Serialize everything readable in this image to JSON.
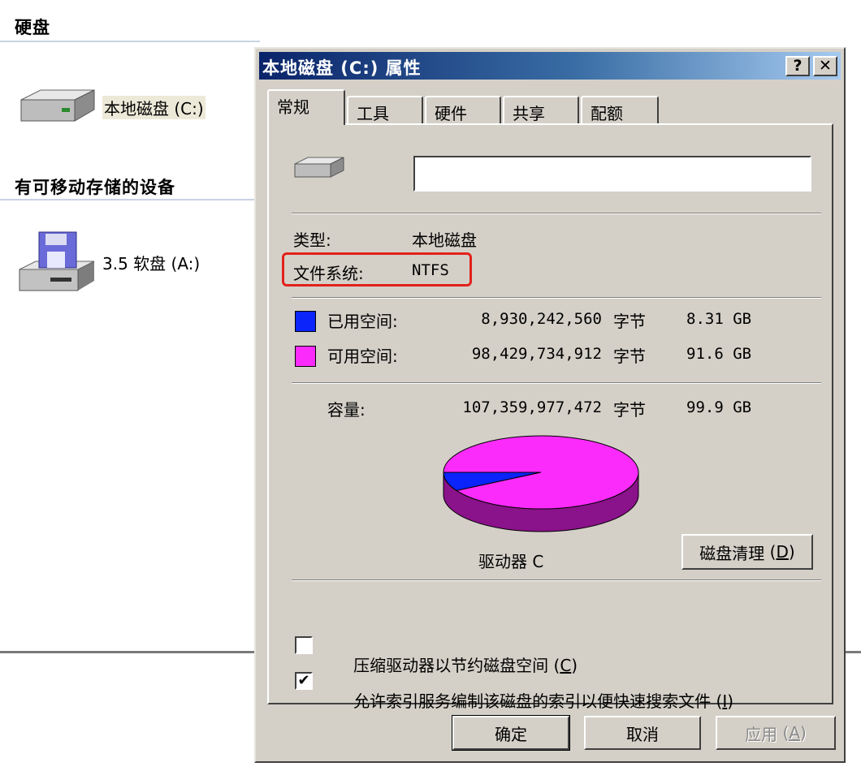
{
  "explorer": {
    "hard_disk_header": "硬盘",
    "local_disk_label": "本地磁盘 (C:)",
    "removable_header": "有可移动存储的设备",
    "floppy_label": "3.5 软盘 (A:)"
  },
  "dialog": {
    "title": "本地磁盘 (C:) 属性",
    "help_button": "?",
    "close_button": "✕",
    "tabs": [
      {
        "label": "常规",
        "active": true
      },
      {
        "label": "工具"
      },
      {
        "label": "硬件"
      },
      {
        "label": "共享"
      },
      {
        "label": "配额"
      }
    ],
    "volume_name_value": "",
    "type_label": "类型:",
    "type_value": "本地磁盘",
    "fs_label": "文件系统:",
    "fs_value": "NTFS",
    "used": {
      "label": "已用空间:",
      "bytes": "8,930,242,560",
      "unit": "字节",
      "size": "8.31 GB",
      "color": "#0b24fb"
    },
    "free": {
      "label": "可用空间:",
      "bytes": "98,429,734,912",
      "unit": "字节",
      "size": "91.6 GB",
      "color": "#fb2bfb"
    },
    "capacity": {
      "label": "容量:",
      "bytes": "107,359,977,472",
      "unit": "字节",
      "size": "99.9 GB"
    },
    "drive_label": "驱动器 C",
    "cleanup_button": "磁盘清理",
    "cleanup_key": "D",
    "compress_label": "压缩驱动器以节约磁盘空间",
    "compress_key": "C",
    "compress_checked": false,
    "index_label": "允许索引服务编制该磁盘的索引以便快速搜索文件",
    "index_key": "I",
    "index_checked": true,
    "ok_button": "确定",
    "cancel_button": "取消",
    "apply_button": "应用",
    "apply_key": "A"
  },
  "chart_data": {
    "type": "pie",
    "title": "",
    "categories": [
      "已用空间",
      "可用空间"
    ],
    "values": [
      8930242560,
      98429734912
    ],
    "colors": [
      "#0b24fb",
      "#fb2bfb"
    ]
  },
  "icons": [
    "hard-drive-icon",
    "floppy-drive-icon",
    "drive-small-icon",
    "checkbox-check-icon"
  ]
}
